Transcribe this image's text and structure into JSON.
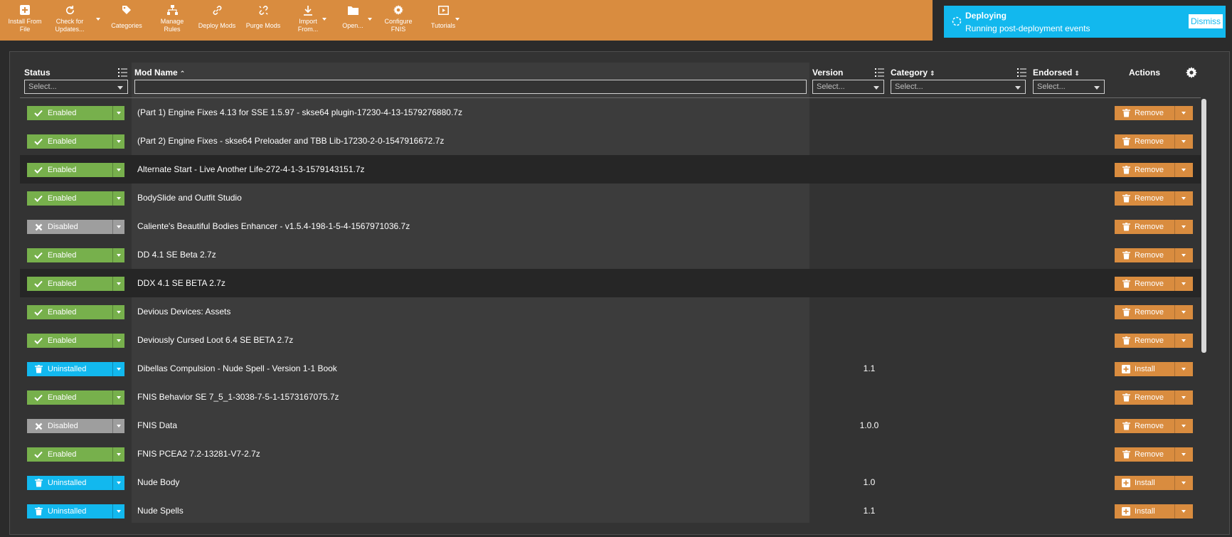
{
  "toolbar": {
    "install_from_file": "Install From\nFile",
    "check_for_updates": "Check for\nUpdates...",
    "categories": "Categories",
    "manage_rules": "Manage\nRules",
    "deploy_mods": "Deploy Mods",
    "purge_mods": "Purge Mods",
    "import_from": "Import\nFrom...",
    "open": "Open...",
    "configure_fnis": "Configure\nFNIS",
    "tutorials": "Tutorials"
  },
  "notification": {
    "title": "Deploying",
    "message": "Running post-deployment events",
    "dismiss": "Dismiss"
  },
  "table": {
    "headers": {
      "status": "Status",
      "mod_name": "Mod Name",
      "version": "Version",
      "category": "Category",
      "endorsed": "Endorsed",
      "actions": "Actions"
    },
    "filters": {
      "status_placeholder": "Select...",
      "version_placeholder": "Select...",
      "category_placeholder": "Select...",
      "endorsed_placeholder": "Select..."
    },
    "rows": [
      {
        "status": "Enabled",
        "name": "(Part 1) Engine Fixes 4.13 for SSE 1.5.97 - skse64 plugin-17230-4-13-1579276880.7z",
        "version": "",
        "action": "Remove"
      },
      {
        "status": "Enabled",
        "name": "(Part 2) Engine Fixes - skse64 Preloader and TBB Lib-17230-2-0-1547916672.7z",
        "version": "",
        "action": "Remove"
      },
      {
        "status": "Enabled",
        "name": "Alternate Start - Live Another Life-272-4-1-3-1579143151.7z",
        "version": "",
        "action": "Remove"
      },
      {
        "status": "Enabled",
        "name": "BodySlide and Outfit Studio",
        "version": "",
        "action": "Remove"
      },
      {
        "status": "Disabled",
        "name": "Caliente's Beautiful Bodies Enhancer - v1.5.4-198-1-5-4-1567971036.7z",
        "version": "",
        "action": "Remove"
      },
      {
        "status": "Enabled",
        "name": "DD 4.1 SE Beta 2.7z",
        "version": "",
        "action": "Remove"
      },
      {
        "status": "Enabled",
        "name": "DDX 4.1 SE BETA 2.7z",
        "version": "",
        "action": "Remove"
      },
      {
        "status": "Enabled",
        "name": "Devious Devices: Assets",
        "version": "",
        "action": "Remove"
      },
      {
        "status": "Enabled",
        "name": "Deviously Cursed Loot 6.4 SE BETA 2.7z",
        "version": "",
        "action": "Remove"
      },
      {
        "status": "Uninstalled",
        "name": "Dibellas Compulsion - Nude Spell - Version 1-1 Book",
        "version": "1.1",
        "action": "Install"
      },
      {
        "status": "Enabled",
        "name": "FNIS Behavior SE 7_5_1-3038-7-5-1-1573167075.7z",
        "version": "",
        "action": "Remove"
      },
      {
        "status": "Disabled",
        "name": "FNIS Data",
        "version": "1.0.0",
        "action": "Remove"
      },
      {
        "status": "Enabled",
        "name": "FNIS PCEA2 7.2-13281-V7-2.7z",
        "version": "",
        "action": "Remove"
      },
      {
        "status": "Uninstalled",
        "name": "Nude Body",
        "version": "1.0",
        "action": "Install"
      },
      {
        "status": "Uninstalled",
        "name": "Nude Spells",
        "version": "1.1",
        "action": "Install"
      }
    ]
  },
  "colors": {
    "accent_orange": "#d98c3f",
    "enabled_green": "#77b04c",
    "disabled_gray": "#9e9e9e",
    "uninstalled_blue": "#12b8ee",
    "background": "#2b2b2b"
  }
}
